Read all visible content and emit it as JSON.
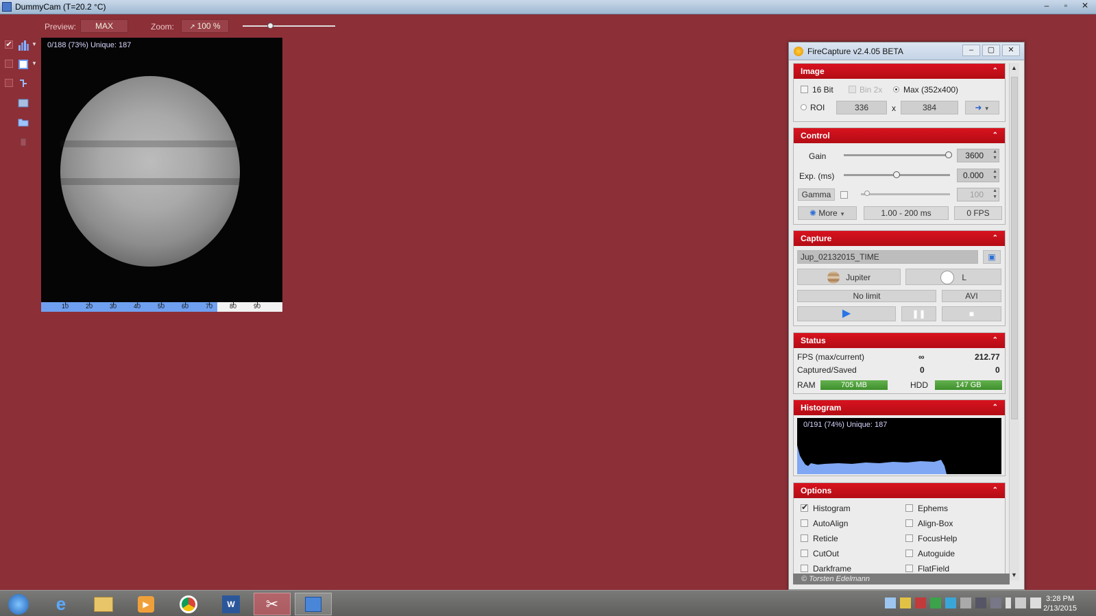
{
  "window": {
    "title": "DummyCam (T=20.2 °C)",
    "buttons": [
      "–",
      "▫",
      "✕"
    ]
  },
  "toolbar": {
    "preview_label": "Preview:",
    "preview_value": "MAX",
    "zoom_label": "Zoom:",
    "zoom_value": "100 %"
  },
  "preview": {
    "info": "0/188 (73%)  Unique: 187",
    "ruler_ticks": [
      "10",
      "20",
      "30",
      "40",
      "50",
      "60",
      "70",
      "80",
      "90"
    ]
  },
  "firecapture": {
    "title": "FireCapture v2.4.05 BETA",
    "image": {
      "header": "Image",
      "bit16_label": "16 Bit",
      "bin_label": "Bin 2x",
      "max_label": "Max (352x400)",
      "roi_label": "ROI",
      "roi_width": "336",
      "roi_x": "x",
      "roi_height": "384"
    },
    "control": {
      "header": "Control",
      "gain_label": "Gain",
      "gain_value": "3600",
      "exp_label": "Exp. (ms)",
      "exp_value": "0.000",
      "gamma_label": "Gamma",
      "gamma_value": "100",
      "more_label": "More",
      "range_value": "1.00 - 200 ms",
      "fps_value": "0 FPS"
    },
    "capture": {
      "header": "Capture",
      "filename": "Jup_02132015_TIME",
      "object_label": "Jupiter",
      "filter_label": "L",
      "limit_label": "No limit",
      "format_label": "AVI"
    },
    "status": {
      "header": "Status",
      "fps_label": "FPS (max/current)",
      "fps_max": "∞",
      "fps_current": "212.77",
      "captured_label": "Captured/Saved",
      "captured_value": "0",
      "saved_value": "0",
      "ram_label": "RAM",
      "ram_value": "705 MB",
      "hdd_label": "HDD",
      "hdd_value": "147 GB"
    },
    "histogram": {
      "header": "Histogram",
      "info": "0/191 (74%)  Unique: 187"
    },
    "options": {
      "header": "Options",
      "left": [
        {
          "label": "Histogram",
          "checked": true
        },
        {
          "label": "AutoAlign",
          "checked": false
        },
        {
          "label": "Reticle",
          "checked": false
        },
        {
          "label": "CutOut",
          "checked": false
        },
        {
          "label": "Darkframe",
          "checked": false
        }
      ],
      "right": [
        {
          "label": "Ephems",
          "checked": false
        },
        {
          "label": "Align-Box",
          "checked": false
        },
        {
          "label": "FocusHelp",
          "checked": false
        },
        {
          "label": "Autoguide",
          "checked": false
        },
        {
          "label": "FlatField",
          "checked": false
        }
      ]
    },
    "footer": "© Torsten Edelmann"
  },
  "taskbar": {
    "time": "3:28 PM",
    "date": "2/13/2015"
  },
  "colors": {
    "desktop_bg": "#8c2f37",
    "section_header": "#c8101a",
    "ram_bar": "#4e9e3a",
    "ruler_fill": "#6fa0f0"
  }
}
